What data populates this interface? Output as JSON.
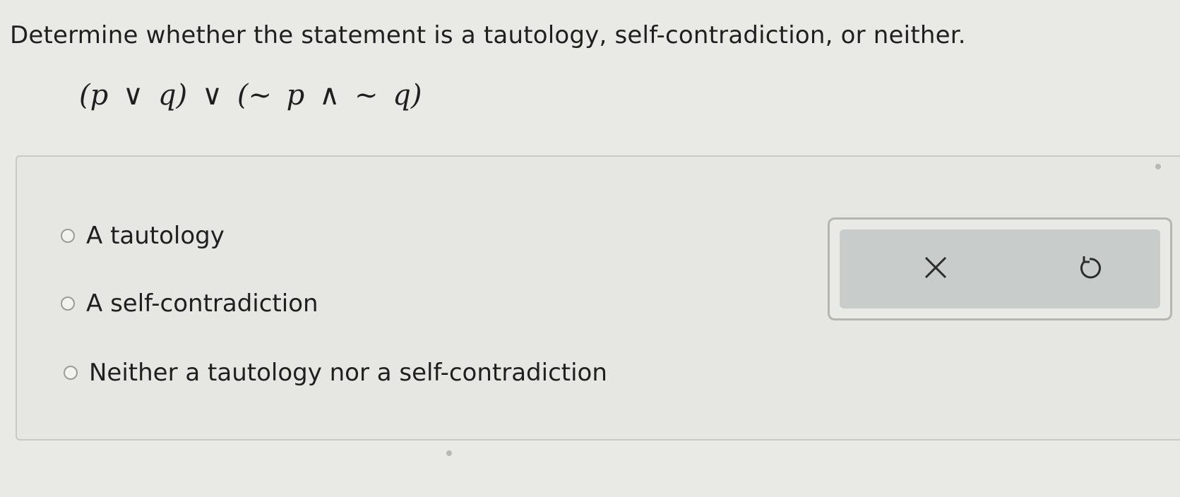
{
  "question": {
    "prompt": "Determine whether the statement is a tautology, self-contradiction, or neither.",
    "formula": "(p ∨ q) ∨ (~ p ∧ ~ q)"
  },
  "options": [
    {
      "label": "A tautology"
    },
    {
      "label": "A self-contradiction"
    },
    {
      "label": "Neither a tautology nor a self-contradiction"
    }
  ],
  "tools": {
    "clear_icon": "x-icon",
    "reset_icon": "undo-icon"
  }
}
